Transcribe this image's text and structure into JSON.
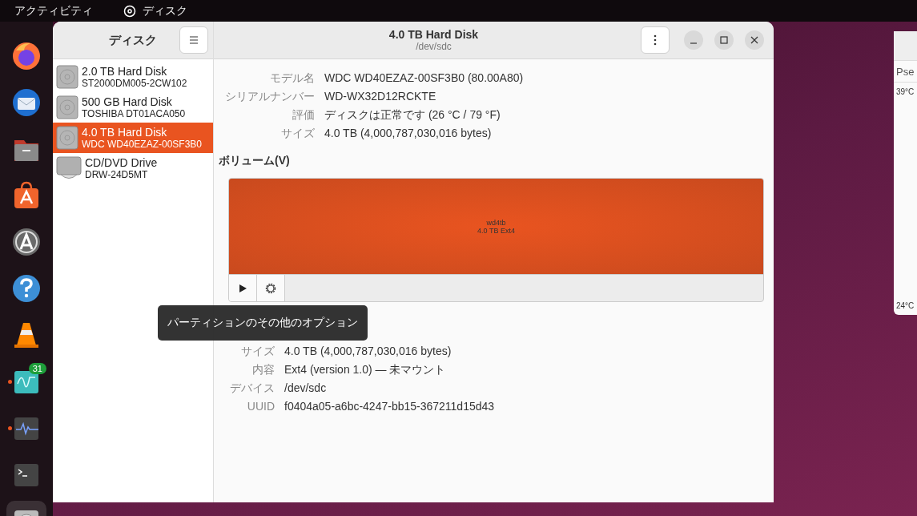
{
  "top_bar": {
    "activities": "アクティビティ",
    "app_name": "ディスク"
  },
  "dock": [
    {
      "running": false,
      "selected": false
    },
    {
      "running": false,
      "selected": false
    },
    {
      "running": false,
      "selected": false
    },
    {
      "running": false,
      "selected": false
    },
    {
      "running": false,
      "selected": false
    },
    {
      "running": false,
      "selected": false
    },
    {
      "running": false,
      "selected": false
    },
    {
      "running": true,
      "badge": "31",
      "selected": false
    },
    {
      "running": true,
      "selected": false
    },
    {
      "running": false,
      "selected": false
    },
    {
      "running": true,
      "selected": true
    }
  ],
  "sidebar": {
    "title": "ディスク",
    "items": [
      {
        "name": "2.0 TB Hard Disk",
        "model": "ST2000DM005-2CW102",
        "kind": "hdd",
        "selected": false
      },
      {
        "name": "500 GB Hard Disk",
        "model": "TOSHIBA DT01ACA050",
        "kind": "hdd",
        "selected": false
      },
      {
        "name": "4.0 TB Hard Disk",
        "model": "WDC WD40EZAZ-00SF3B0",
        "kind": "hdd",
        "selected": true
      },
      {
        "name": "CD/DVD Drive",
        "model": "DRW-24D5MT",
        "kind": "optical",
        "selected": false
      }
    ]
  },
  "header": {
    "title": "4.0 TB Hard Disk",
    "subtitle": "/dev/sdc"
  },
  "drive_info": [
    {
      "label": "モデル名",
      "value": "WDC WD40EZAZ-00SF3B0 (80.00A80)"
    },
    {
      "label": "シリアルナンバー",
      "value": "WD-WX32D12RCKTE"
    },
    {
      "label": "評価",
      "value": "ディスクは正常です (26 °C / 79 °F)"
    },
    {
      "label": "サイズ",
      "value": "4.0 TB (4,000,787,030,016 bytes)"
    }
  ],
  "volumes": {
    "heading": "ボリューム(V)",
    "partitions": [
      {
        "name": "wd4tb",
        "detail": "4.0 TB Ext4",
        "selected": true
      }
    ],
    "tooltip": "パーティションのその他のオプション",
    "info": [
      {
        "label": "サイズ",
        "value": "4.0 TB (4,000,787,030,016 bytes)"
      },
      {
        "label": "内容",
        "value": "Ext4 (version 1.0) — 未マウント"
      },
      {
        "label": "デバイス",
        "value": "/dev/sdc"
      },
      {
        "label": "UUID",
        "value": "f0404a05-a6bc-4247-bb15-367211d15d43"
      }
    ]
  },
  "background_window": {
    "tab": "Pse",
    "axis_top": "39°C",
    "axis_bottom": "24°C"
  }
}
